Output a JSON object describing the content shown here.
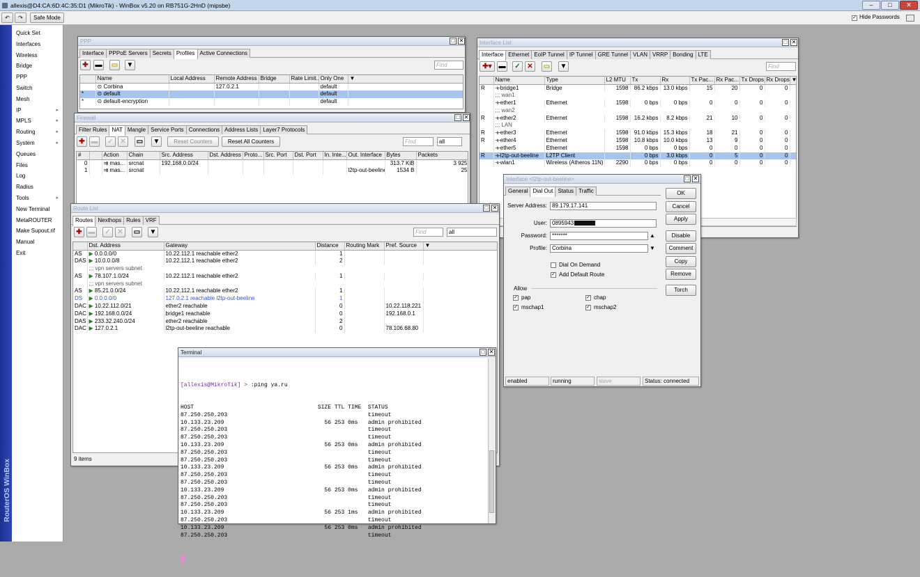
{
  "app": {
    "title": "allexis@D4:CA:6D:4C:35:D1 (MikroTik) - WinBox v5.20 on RB751G-2HnD (mipsbe)",
    "safe_mode": "Safe Mode",
    "hide_passwords": "Hide Passwords",
    "brand": "RouterOS WinBox"
  },
  "menu": [
    {
      "label": "Quick Set"
    },
    {
      "label": "Interfaces"
    },
    {
      "label": "Wireless"
    },
    {
      "label": "Bridge"
    },
    {
      "label": "PPP"
    },
    {
      "label": "Switch"
    },
    {
      "label": "Mesh"
    },
    {
      "label": "IP",
      "sub": "▸"
    },
    {
      "label": "MPLS",
      "sub": "▸"
    },
    {
      "label": "Routing",
      "sub": "▸"
    },
    {
      "label": "System",
      "sub": "▸"
    },
    {
      "label": "Queues"
    },
    {
      "label": "Files"
    },
    {
      "label": "Log"
    },
    {
      "label": "Radius"
    },
    {
      "label": "Tools",
      "sub": "▸"
    },
    {
      "label": "New Terminal"
    },
    {
      "label": "MetaROUTER"
    },
    {
      "label": "Make Supout.rif"
    },
    {
      "label": "Manual"
    },
    {
      "label": "Exit"
    }
  ],
  "ppp": {
    "title": "PPP",
    "tabs": [
      "Interface",
      "PPPoE Servers",
      "Secrets",
      "Profiles",
      "Active Connections"
    ],
    "active_tab": 3,
    "find": "Find",
    "columns": [
      "Name",
      "Local Address",
      "Remote Address",
      "Bridge",
      "Rate Limit...",
      "Only One"
    ],
    "rows": [
      {
        "flag": "",
        "name": "Corbina",
        "local": "",
        "remote": "127.0.2.1",
        "bridge": "",
        "rate": "",
        "only": "default"
      },
      {
        "flag": "*",
        "name": "default",
        "local": "",
        "remote": "",
        "bridge": "",
        "rate": "",
        "only": "default"
      },
      {
        "flag": "*",
        "name": "default-encryption",
        "local": "",
        "remote": "",
        "bridge": "",
        "rate": "",
        "only": "default"
      }
    ]
  },
  "firewall": {
    "title": "Firewall",
    "tabs": [
      "Filter Rules",
      "NAT",
      "Mangle",
      "Service Ports",
      "Connections",
      "Address Lists",
      "Layer7 Protocols"
    ],
    "active_tab": 1,
    "reset": "Reset Counters",
    "reset_all": "Reset All Counters",
    "find": "Find",
    "filter": "all",
    "columns": [
      "#",
      "Action",
      "Chain",
      "Src. Address",
      "Dst. Address",
      "Proto...",
      "Src. Port",
      "Dst. Port",
      "In. Inte...",
      "Out. Interface",
      "Bytes",
      "Packets"
    ],
    "rows": [
      {
        "n": "0",
        "action": "mas...",
        "chain": "srcnat",
        "src": "192.168.0.0/24",
        "dst": "",
        "proto": "",
        "sport": "",
        "dport": "",
        "in": "",
        "out": "",
        "bytes": "313.7 KiB",
        "packets": "3 925"
      },
      {
        "n": "1",
        "action": "mas...",
        "chain": "srcnat",
        "src": "",
        "dst": "",
        "proto": "",
        "sport": "",
        "dport": "",
        "in": "",
        "out": "l2tp-out-beeline",
        "bytes": "1534 B",
        "packets": "25"
      }
    ]
  },
  "routes": {
    "title": "Route List",
    "tabs": [
      "Routes",
      "Nexthops",
      "Rules",
      "VRF"
    ],
    "active_tab": 0,
    "find": "Find",
    "filter": "all",
    "status": "9 items",
    "columns": [
      "Dst. Address",
      "Gateway",
      "Distance",
      "Routing Mark",
      "Pref. Source"
    ],
    "rows": [
      {
        "flag": "AS",
        "dst": "0.0.0.0/0",
        "gw": "10.22.112.1 reachable ether2",
        "dist": "1",
        "mark": "",
        "pref": "",
        "t": ""
      },
      {
        "flag": "DAS",
        "dst": "10.0.0.0/8",
        "gw": "10.22.112.1 reachable ether2",
        "dist": "2",
        "mark": "",
        "pref": "",
        "t": ""
      },
      {
        "flag": "",
        "dst": ";;; vpn servers subnet",
        "gw": "",
        "dist": "",
        "mark": "",
        "pref": "",
        "t": "cm"
      },
      {
        "flag": "AS",
        "dst": "78.107.1.0/24",
        "gw": "10.22.112.1 reachable ether2",
        "dist": "1",
        "mark": "",
        "pref": "",
        "t": ""
      },
      {
        "flag": "",
        "dst": ";;; vpn servers subnet",
        "gw": "",
        "dist": "",
        "mark": "",
        "pref": "",
        "t": "cm"
      },
      {
        "flag": "AS",
        "dst": "85.21.0.0/24",
        "gw": "10.22.112.1 reachable ether2",
        "dist": "1",
        "mark": "",
        "pref": "",
        "t": ""
      },
      {
        "flag": "DS",
        "dst": "0.0.0.0/0",
        "gw": "127.0.2.1 reachable l2tp-out-beeline",
        "dist": "1",
        "mark": "",
        "pref": "",
        "t": "dis"
      },
      {
        "flag": "DAC",
        "dst": "10.22.112.0/21",
        "gw": "ether2 reachable",
        "dist": "0",
        "mark": "",
        "pref": "10.22.118.221",
        "t": ""
      },
      {
        "flag": "DAC",
        "dst": "192.168.0.0/24",
        "gw": "bridge1 reachable",
        "dist": "0",
        "mark": "",
        "pref": "192.168.0.1",
        "t": ""
      },
      {
        "flag": "DAS",
        "dst": "233.32.240.0/24",
        "gw": "ether2 reachable",
        "dist": "2",
        "mark": "",
        "pref": "",
        "t": ""
      },
      {
        "flag": "DAC",
        "dst": "127.0.2.1",
        "gw": "l2tp-out-beeline reachable",
        "dist": "0",
        "mark": "",
        "pref": "78.106.68.80",
        "t": ""
      }
    ]
  },
  "iflist": {
    "title": "Interface List",
    "tabs": [
      "Interface",
      "Ethernet",
      "EoIP Tunnel",
      "IP Tunnel",
      "GRE Tunnel",
      "VLAN",
      "VRRP",
      "Bonding",
      "LTE"
    ],
    "active_tab": 0,
    "find": "Find",
    "columns": [
      "Name",
      "Type",
      "L2 MTU",
      "Tx",
      "Rx",
      "Tx Pac...",
      "Rx Pac...",
      "Tx Drops",
      "Rx Drops"
    ],
    "rows": [
      {
        "flag": "R",
        "name": "bridge1",
        "type": "Bridge",
        "mtu": "1598",
        "tx": "86.2 kbps",
        "rx": "13.0 kbps",
        "txp": "15",
        "rxp": "20",
        "txd": "0",
        "rxd": "0",
        "t": ""
      },
      {
        "flag": "",
        "name": ";;; wan1",
        "t": "cm"
      },
      {
        "flag": "",
        "name": "ether1",
        "type": "Ethernet",
        "mtu": "1598",
        "tx": "0 bps",
        "rx": "0 bps",
        "txp": "0",
        "rxp": "0",
        "txd": "0",
        "rxd": "0",
        "t": ""
      },
      {
        "flag": "",
        "name": ";;; wan2",
        "t": "cm"
      },
      {
        "flag": "R",
        "name": "ether2",
        "type": "Ethernet",
        "mtu": "1598",
        "tx": "16.2 kbps",
        "rx": "8.2 kbps",
        "txp": "21",
        "rxp": "10",
        "txd": "0",
        "rxd": "0",
        "t": ""
      },
      {
        "flag": "",
        "name": ";;; LAN",
        "t": "cm"
      },
      {
        "flag": "R",
        "name": "ether3",
        "type": "Ethernet",
        "mtu": "1598",
        "tx": "91.0 kbps",
        "rx": "15.3 kbps",
        "txp": "18",
        "rxp": "21",
        "txd": "0",
        "rxd": "0",
        "t": ""
      },
      {
        "flag": "R",
        "name": "ether4",
        "type": "Ethernet",
        "mtu": "1598",
        "tx": "10.8 kbps",
        "rx": "10.0 kbps",
        "txp": "13",
        "rxp": "9",
        "txd": "0",
        "rxd": "0",
        "t": ""
      },
      {
        "flag": "",
        "name": "ether5",
        "type": "Ethernet",
        "mtu": "1598",
        "tx": "0 bps",
        "rx": "0 bps",
        "txp": "0",
        "rxp": "0",
        "txd": "0",
        "rxd": "0",
        "t": ""
      },
      {
        "flag": "R",
        "name": "l2tp-out-beeline",
        "type": "L2TP Client",
        "mtu": "",
        "tx": "0 bps",
        "rx": "3.0 kbps",
        "txp": "0",
        "rxp": "5",
        "txd": "0",
        "rxd": "0",
        "t": "hl"
      },
      {
        "flag": "",
        "name": "wlan1",
        "type": "Wireless (Atheros 11N)",
        "mtu": "2290",
        "tx": "0 bps",
        "rx": "0 bps",
        "txp": "0",
        "rxp": "0",
        "txd": "0",
        "rxd": "0",
        "t": ""
      }
    ]
  },
  "ifdialog": {
    "title": "Interface <l2tp-out-beeline>",
    "tabs": [
      "General",
      "Dial Out",
      "Status",
      "Traffic"
    ],
    "active_tab": 1,
    "server_label": "Server Address:",
    "server": "89.179.17.141",
    "user_label": "User:",
    "user": "0895943",
    "password_label": "Password:",
    "password": "*******",
    "profile_label": "Profile:",
    "profile": "Corbina",
    "dial_on_demand": "Dial On Demand",
    "add_default_route": "Add Default Route",
    "allow": "Allow",
    "pap": "pap",
    "chap": "chap",
    "mschap1": "mschap1",
    "mschap2": "mschap2",
    "buttons": [
      "OK",
      "Cancel",
      "Apply",
      "Disable",
      "Comment",
      "Copy",
      "Remove",
      "Torch"
    ],
    "status": [
      "enabled",
      "running",
      "slave",
      "Status: connected"
    ]
  },
  "terminal": {
    "title": "Terminal",
    "prompt": "[allexis@MikroTik] >",
    "command": " :ping ya.ru",
    "lines": [
      "HOST                                     SIZE TTL TIME  STATUS",
      "87.250.250.203                                          timeout",
      "10.133.23.209                              56 253 0ms   admin prohibited",
      "87.250.250.203                                          timeout",
      "87.250.250.203                                          timeout",
      "10.133.23.209                              56 253 0ms   admin prohibited",
      "87.250.250.203                                          timeout",
      "87.250.250.203                                          timeout",
      "10.133.23.209                              56 253 0ms   admin prohibited",
      "87.250.250.203                                          timeout",
      "87.250.250.203                                          timeout",
      "10.133.23.209                              56 253 0ms   admin prohibited",
      "87.250.250.203                                          timeout",
      "87.250.250.203                                          timeout",
      "10.133.23.209                              56 253 1ms   admin prohibited",
      "87.250.250.203                                          timeout",
      "10.133.23.209                              56 253 0ms   admin prohibited",
      "87.250.250.203                                          timeout"
    ]
  }
}
